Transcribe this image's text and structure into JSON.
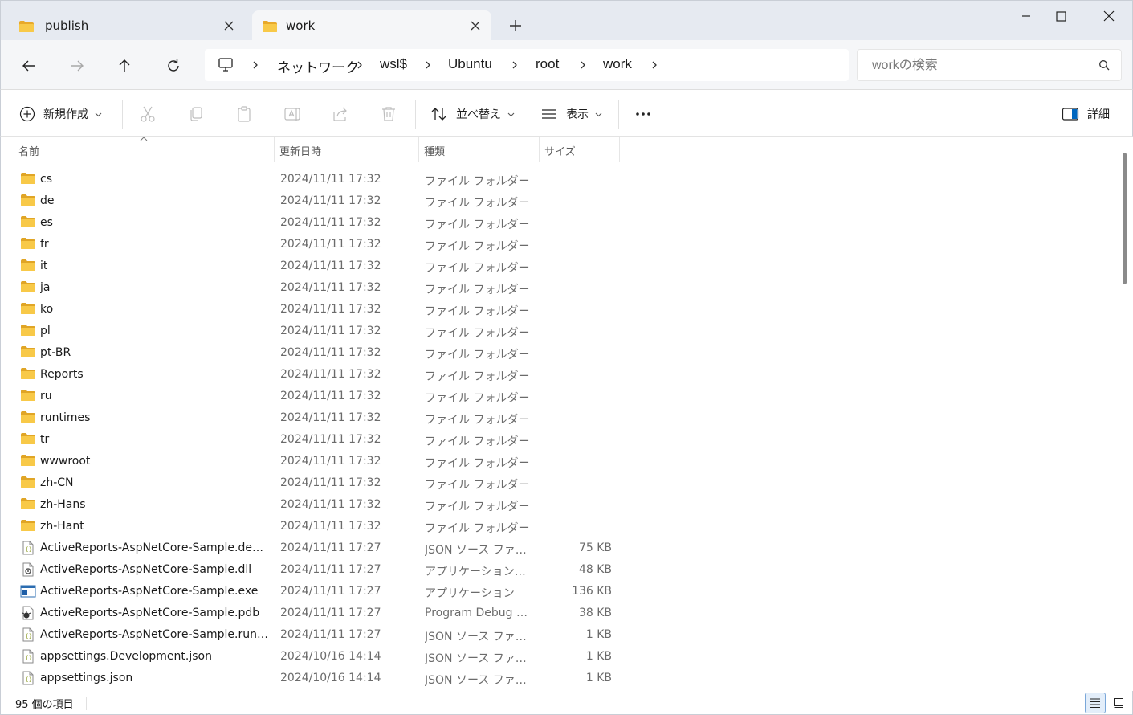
{
  "tabs": [
    {
      "label": "publish",
      "active": false
    },
    {
      "label": "work",
      "active": true
    }
  ],
  "breadcrumb": [
    "ネットワーク",
    "wsl$",
    "Ubuntu",
    "root",
    "work"
  ],
  "search": {
    "placeholder": "workの検索"
  },
  "toolbar": {
    "new_label": "新規作成",
    "sort_label": "並べ替え",
    "view_label": "表示",
    "details_label": "詳細"
  },
  "columns": {
    "name": "名前",
    "date": "更新日時",
    "type": "種類",
    "size": "サイズ"
  },
  "files": [
    {
      "name": "cs",
      "date": "2024/11/11 17:32",
      "type": "ファイル フォルダー",
      "size": "",
      "icon": "folder-icon"
    },
    {
      "name": "de",
      "date": "2024/11/11 17:32",
      "type": "ファイル フォルダー",
      "size": "",
      "icon": "folder-icon"
    },
    {
      "name": "es",
      "date": "2024/11/11 17:32",
      "type": "ファイル フォルダー",
      "size": "",
      "icon": "folder-icon"
    },
    {
      "name": "fr",
      "date": "2024/11/11 17:32",
      "type": "ファイル フォルダー",
      "size": "",
      "icon": "folder-icon"
    },
    {
      "name": "it",
      "date": "2024/11/11 17:32",
      "type": "ファイル フォルダー",
      "size": "",
      "icon": "folder-icon"
    },
    {
      "name": "ja",
      "date": "2024/11/11 17:32",
      "type": "ファイル フォルダー",
      "size": "",
      "icon": "folder-icon"
    },
    {
      "name": "ko",
      "date": "2024/11/11 17:32",
      "type": "ファイル フォルダー",
      "size": "",
      "icon": "folder-icon"
    },
    {
      "name": "pl",
      "date": "2024/11/11 17:32",
      "type": "ファイル フォルダー",
      "size": "",
      "icon": "folder-icon"
    },
    {
      "name": "pt-BR",
      "date": "2024/11/11 17:32",
      "type": "ファイル フォルダー",
      "size": "",
      "icon": "folder-icon"
    },
    {
      "name": "Reports",
      "date": "2024/11/11 17:32",
      "type": "ファイル フォルダー",
      "size": "",
      "icon": "folder-icon"
    },
    {
      "name": "ru",
      "date": "2024/11/11 17:32",
      "type": "ファイル フォルダー",
      "size": "",
      "icon": "folder-icon"
    },
    {
      "name": "runtimes",
      "date": "2024/11/11 17:32",
      "type": "ファイル フォルダー",
      "size": "",
      "icon": "folder-icon"
    },
    {
      "name": "tr",
      "date": "2024/11/11 17:32",
      "type": "ファイル フォルダー",
      "size": "",
      "icon": "folder-icon"
    },
    {
      "name": "wwwroot",
      "date": "2024/11/11 17:32",
      "type": "ファイル フォルダー",
      "size": "",
      "icon": "folder-icon"
    },
    {
      "name": "zh-CN",
      "date": "2024/11/11 17:32",
      "type": "ファイル フォルダー",
      "size": "",
      "icon": "folder-icon"
    },
    {
      "name": "zh-Hans",
      "date": "2024/11/11 17:32",
      "type": "ファイル フォルダー",
      "size": "",
      "icon": "folder-icon"
    },
    {
      "name": "zh-Hant",
      "date": "2024/11/11 17:32",
      "type": "ファイル フォルダー",
      "size": "",
      "icon": "folder-icon"
    },
    {
      "name": "ActiveReports-AspNetCore-Sample.deps....",
      "date": "2024/11/11 17:27",
      "type": "JSON ソース ファイル",
      "size": "75 KB",
      "icon": "json-file-icon"
    },
    {
      "name": "ActiveReports-AspNetCore-Sample.dll",
      "date": "2024/11/11 17:27",
      "type": "アプリケーション拡張",
      "size": "48 KB",
      "icon": "dll-file-icon"
    },
    {
      "name": "ActiveReports-AspNetCore-Sample.exe",
      "date": "2024/11/11 17:27",
      "type": "アプリケーション",
      "size": "136 KB",
      "icon": "exe-file-icon"
    },
    {
      "name": "ActiveReports-AspNetCore-Sample.pdb",
      "date": "2024/11/11 17:27",
      "type": "Program Debug D...",
      "size": "38 KB",
      "icon": "pdb-file-icon"
    },
    {
      "name": "ActiveReports-AspNetCore-Sample.runti...",
      "date": "2024/11/11 17:27",
      "type": "JSON ソース ファイル",
      "size": "1 KB",
      "icon": "json-file-icon"
    },
    {
      "name": "appsettings.Development.json",
      "date": "2024/10/16 14:14",
      "type": "JSON ソース ファイル",
      "size": "1 KB",
      "icon": "json-file-icon"
    },
    {
      "name": "appsettings.json",
      "date": "2024/10/16 14:14",
      "type": "JSON ソース ファイル",
      "size": "1 KB",
      "icon": "json-file-icon"
    }
  ],
  "status": {
    "count": "95 個の項目"
  },
  "colors": {
    "folder": "#f6c344",
    "folder_dark": "#e0a526",
    "accent": "#0067c0",
    "titlebar": "#e6eaf1"
  }
}
